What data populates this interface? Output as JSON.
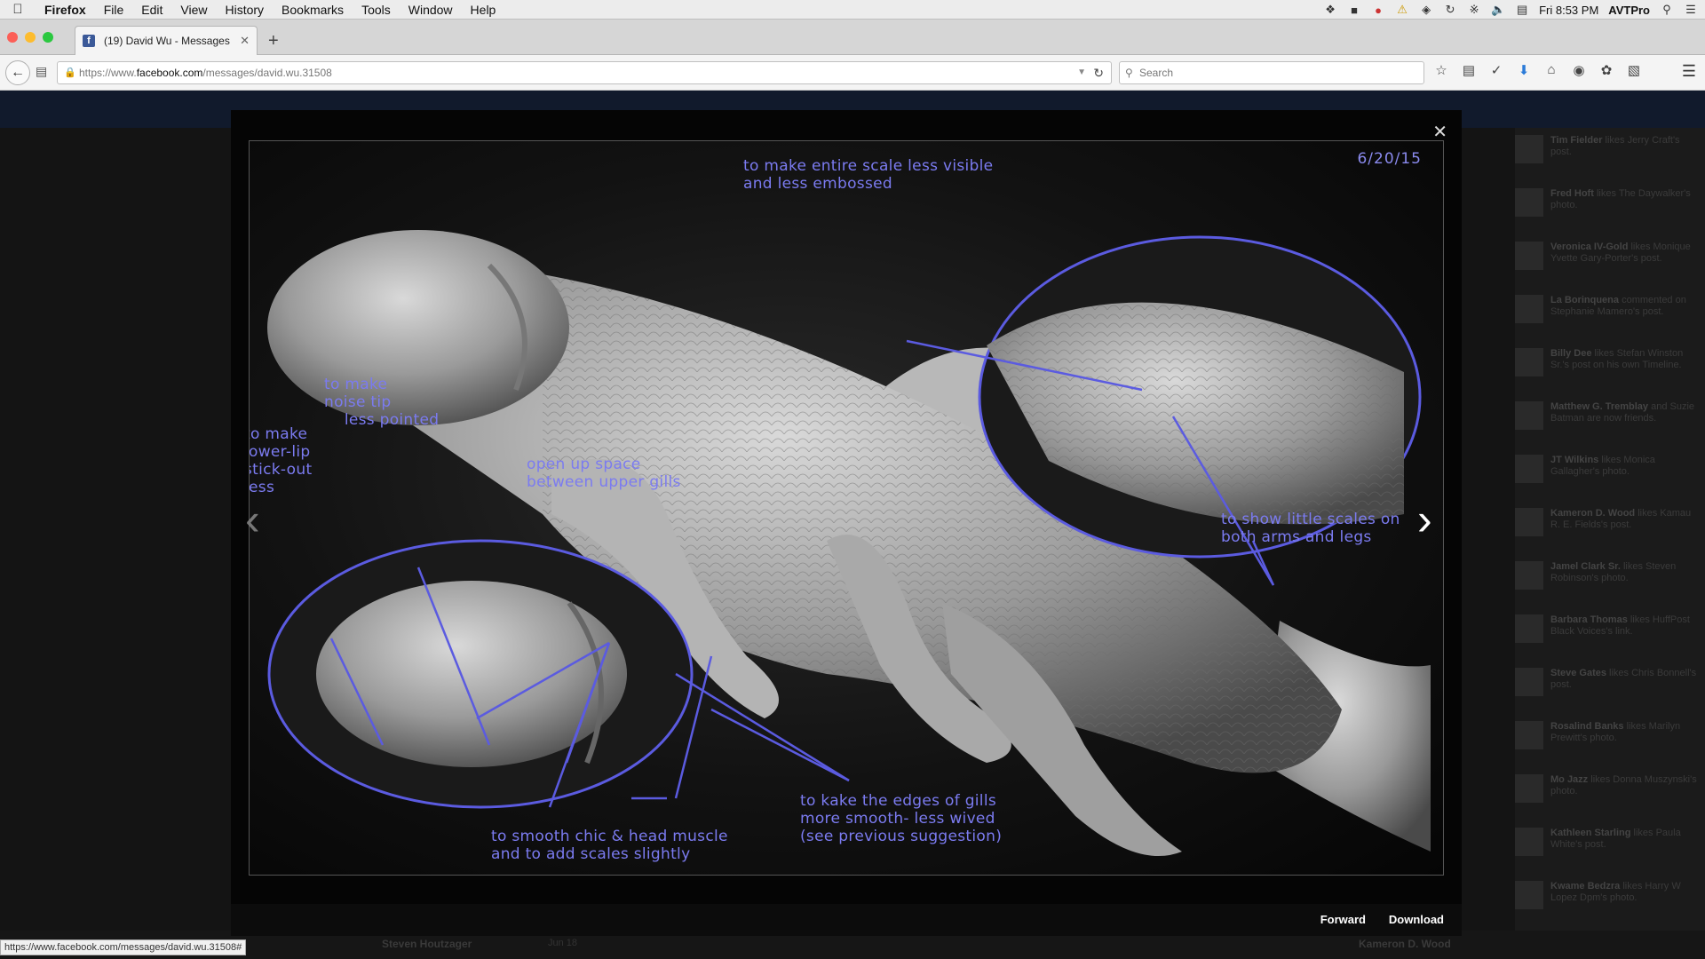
{
  "menubar": {
    "app": "Firefox",
    "items": [
      "File",
      "Edit",
      "View",
      "History",
      "Bookmarks",
      "Tools",
      "Window",
      "Help"
    ],
    "clock": "Fri 8:53 PM",
    "user": "AVTPro"
  },
  "tab": {
    "title": "(19) David Wu - Messages",
    "favicon": "f"
  },
  "navbar": {
    "url_prefix": "https://www.",
    "url_host": "facebook.com",
    "url_path": "/messages/david.wu.31508",
    "search_placeholder": "Search"
  },
  "viewer": {
    "date": "6/20/15",
    "forward_label": "Forward",
    "download_label": "Download",
    "annotations": {
      "scale": "to make entire scale less visible\nand less embossed",
      "nose": "to make\nnoise tip\n    less pointed",
      "lip": "to make\nlower-lip\nstick-out\nless",
      "gills_open": "open up space\nbetween upper gills",
      "arms_legs": "to show little scales on\nboth arms and legs",
      "chin": "to smooth chic & head muscle\nand to add scales slightly",
      "gill_edges": "to kake the edges of gills\nmore smooth- less wived\n(see previous suggestion)"
    },
    "annotation_color": "#5b5be0"
  },
  "ticker": [
    {
      "name": "Tim Fielder",
      "text": "likes Jerry Craft's post."
    },
    {
      "name": "Fred Hoft",
      "text": "likes The Daywalker's photo."
    },
    {
      "name": "Veronica IV-Gold",
      "text": "likes Monique Yvette Gary-Porter's post."
    },
    {
      "name": "La Borinquena",
      "text": "commented on Stephanie Mamero's post."
    },
    {
      "name": "Billy Dee",
      "text": "likes Stefan Winston Sr.'s post on his own Timeline."
    },
    {
      "name": "Matthew G. Tremblay",
      "text": "and Suzie Batman are now friends."
    },
    {
      "name": "JT Wilkins",
      "text": "likes Monica Gallagher's photo."
    },
    {
      "name": "Kameron D. Wood",
      "text": "likes Kamau R. E. Fields's post."
    },
    {
      "name": "Jamel Clark Sr.",
      "text": "likes Steven Robinson's photo."
    },
    {
      "name": "Barbara Thomas",
      "text": "likes HuffPost Black Voices's link."
    },
    {
      "name": "Steve Gates",
      "text": "likes Chris Bonnell's post."
    },
    {
      "name": "Rosalind Banks",
      "text": "likes Marilyn Prewitt's photo."
    },
    {
      "name": "Mo Jazz",
      "text": "likes Donna Muszynski's photo."
    },
    {
      "name": "Kathleen Starling",
      "text": "likes Paula White's post."
    },
    {
      "name": "Kwame Bedzra",
      "text": "likes Harry W Lopez Dpm's photo."
    }
  ],
  "bottom": {
    "name": "Steven Houtzager",
    "date": "Jun 18",
    "right_name": "Kameron D. Wood"
  },
  "statusbar": {
    "url": "https://www.facebook.com/messages/david.wu.31508#"
  }
}
